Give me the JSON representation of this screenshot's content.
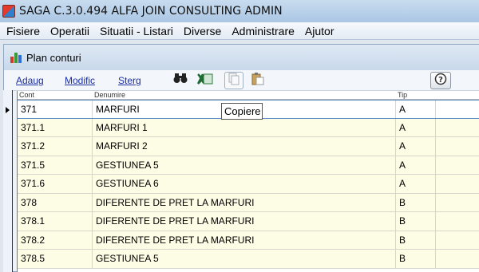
{
  "app": {
    "title": "SAGA C.3.0.494  ALFA JOIN CONSULTING  ADMIN"
  },
  "menu": [
    "Fisiere",
    "Operatii",
    "Situatii - Listari",
    "Diverse",
    "Administrare",
    "Ajutor"
  ],
  "window": {
    "title": "Plan conturi"
  },
  "toolbar": {
    "add_label": "Adaug",
    "edit_label": "Modific",
    "delete_label": "Sterg"
  },
  "grid": {
    "columns": {
      "cont": "Cont",
      "denumire": "Denumire",
      "tip": "Tip"
    },
    "rows": [
      {
        "cont": "371",
        "denumire": "MARFURI",
        "tip": "A"
      },
      {
        "cont": "371.1",
        "denumire": "MARFURI 1",
        "tip": "A"
      },
      {
        "cont": "371.2",
        "denumire": "MARFURI 2",
        "tip": "A"
      },
      {
        "cont": "371.5",
        "denumire": "GESTIUNEA 5",
        "tip": "A"
      },
      {
        "cont": "371.6",
        "denumire": "GESTIUNEA 6",
        "tip": "A"
      },
      {
        "cont": "378",
        "denumire": "DIFERENTE DE PRET LA MARFURI",
        "tip": "B"
      },
      {
        "cont": "378.1",
        "denumire": "DIFERENTE DE PRET LA MARFURI",
        "tip": "B"
      },
      {
        "cont": "378.2",
        "denumire": "DIFERENTE DE PRET LA MARFURI",
        "tip": "B"
      },
      {
        "cont": "378.5",
        "denumire": "GESTIUNEA 5",
        "tip": "B"
      }
    ]
  },
  "tooltip": {
    "text": "Copiere"
  },
  "icons": {
    "app": "saga-app-icon",
    "window": "bar-chart-icon",
    "find": "binoculars-icon",
    "excel": "excel-icon",
    "copy": "copy-icon",
    "paste": "paste-icon",
    "help": "help-icon"
  },
  "colors": {
    "row_background": "#fdfde6",
    "selected_row_background": "#ffffff",
    "link": "#1a2ea0"
  }
}
